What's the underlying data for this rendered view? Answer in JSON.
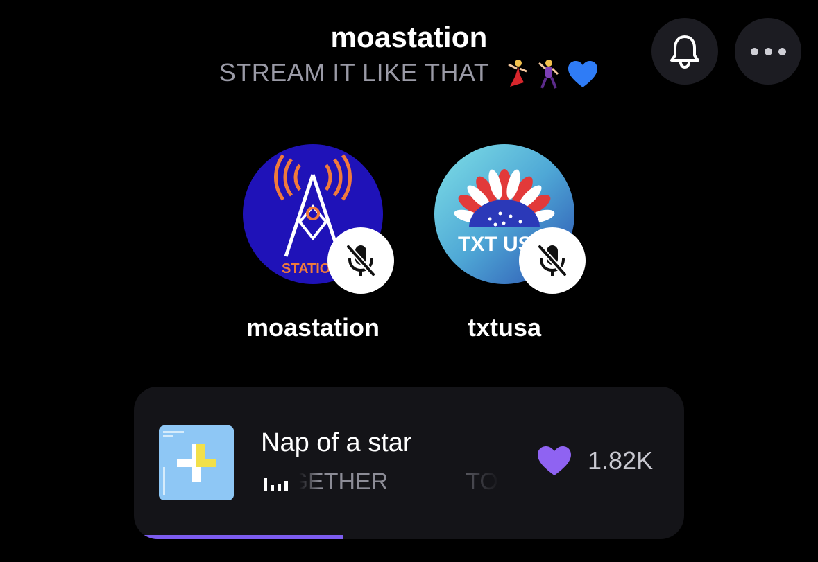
{
  "header": {
    "title": "moastation",
    "subtitle": "STREAM IT LIKE THAT",
    "subtitle_emoji": [
      "dancing-woman-emoji",
      "dancing-man-emoji",
      "blue-heart-emoji"
    ]
  },
  "header_actions": {
    "notifications_icon": "bell-icon",
    "more_icon": "more-horizontal-icon"
  },
  "speakers": [
    {
      "name": "moastation",
      "muted": true,
      "avatar_text": "STATIO"
    },
    {
      "name": "txtusa",
      "muted": true,
      "avatar_text": "TXT US"
    }
  ],
  "now_playing": {
    "track_title": "Nap of a star",
    "artist_scroll_a": "TOGETHER",
    "artist_scroll_b": "TOMORROW X TOGETHER",
    "likes": "1.82K",
    "progress": 0.38
  },
  "colors": {
    "background": "#000000",
    "card": "#141418",
    "accent": "#7c5cf0",
    "heart": "#8f63f2"
  }
}
